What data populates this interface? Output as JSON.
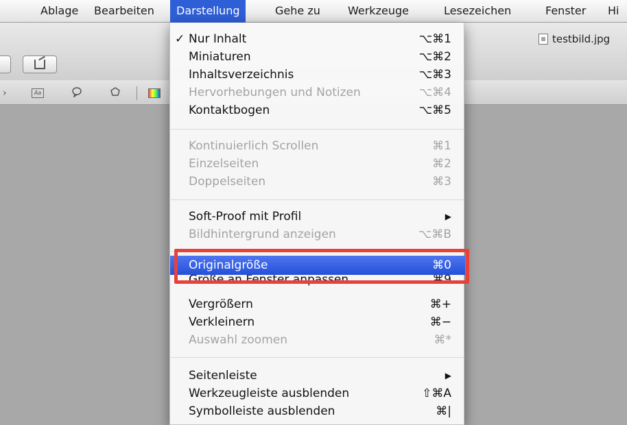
{
  "menubar": {
    "items": [
      {
        "label": "Ablage"
      },
      {
        "label": "Bearbeiten"
      },
      {
        "label": "Darstellung"
      },
      {
        "label": "Gehe zu"
      },
      {
        "label": "Werkzeuge"
      },
      {
        "label": "Lesezeichen"
      },
      {
        "label": "Fenster"
      },
      {
        "label": "Hi"
      }
    ],
    "active_index": 2
  },
  "window": {
    "document_title": "testbild.jpg"
  },
  "colors": {
    "highlight": "#2f5fd6",
    "callout": "#e8403a",
    "content_background": "#a8a8a8"
  },
  "view_menu": {
    "group1": [
      {
        "label": "Nur Inhalt",
        "shortcut": "⌥⌘1",
        "checked": true,
        "enabled": true
      },
      {
        "label": "Miniaturen",
        "shortcut": "⌥⌘2",
        "enabled": true
      },
      {
        "label": "Inhaltsverzeichnis",
        "shortcut": "⌥⌘3",
        "enabled": true
      },
      {
        "label": "Hervorhebungen und Notizen",
        "shortcut": "⌥⌘4",
        "enabled": false
      },
      {
        "label": "Kontaktbogen",
        "shortcut": "⌥⌘5",
        "enabled": true
      }
    ],
    "group2": [
      {
        "label": "Kontinuierlich Scrollen",
        "shortcut": "⌘1",
        "enabled": false
      },
      {
        "label": "Einzelseiten",
        "shortcut": "⌘2",
        "enabled": false
      },
      {
        "label": "Doppelseiten",
        "shortcut": "⌘3",
        "enabled": false
      }
    ],
    "group3": [
      {
        "label": "Soft-Proof mit Profil",
        "submenu": true,
        "enabled": true
      },
      {
        "label": "Bildhintergrund anzeigen",
        "shortcut": "⌥⌘B",
        "enabled": false
      }
    ],
    "group4": [
      {
        "label": "Originalgröße",
        "shortcut": "⌘0",
        "enabled": true,
        "highlighted": true
      },
      {
        "label": "Größe an Fenster anpassen",
        "shortcut": "⌘9",
        "enabled": true
      },
      {
        "label": "Vergrößern",
        "shortcut": "⌘+",
        "enabled": true
      },
      {
        "label": "Verkleinern",
        "shortcut": "⌘−",
        "enabled": true
      },
      {
        "label": "Auswahl zoomen",
        "shortcut": "⌘*",
        "enabled": false
      }
    ],
    "group5": [
      {
        "label": "Seitenleiste",
        "submenu": true,
        "enabled": true
      },
      {
        "label": "Werkzeugleiste ausblenden",
        "shortcut": "⇧⌘A",
        "enabled": true
      },
      {
        "label": "Symbolleiste ausblenden",
        "shortcut": "⌘|",
        "enabled": true
      }
    ]
  }
}
